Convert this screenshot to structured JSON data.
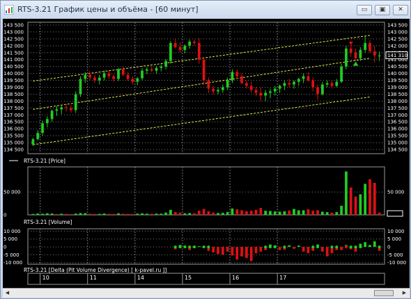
{
  "window": {
    "title": "RTS-3.21 График цены и объёма - [60 минут]",
    "buttons": [
      "minimize",
      "restore",
      "close"
    ],
    "minimize_glyph": "▭",
    "restore_glyph": "▣",
    "close_glyph": "✕"
  },
  "colors": {
    "up": "#22cc22",
    "down": "#dd1111",
    "channel": "#e6e64a",
    "grid": "#7a7a7a",
    "text": "#ffffff",
    "background": "#000000"
  },
  "chart_data": [
    {
      "type": "bar",
      "title": "RTS-3.21 [Price]",
      "ylim": [
        134200,
        143700
      ],
      "y_ticks": [
        "143 500",
        "143 000",
        "142 500",
        "142 000",
        "141 500",
        "141 000",
        "140 500",
        "140 000",
        "139 500",
        "139 000",
        "138 500",
        "138 000",
        "137 500",
        "137 000",
        "136 500",
        "136 000",
        "135 500",
        "135 000",
        "134 500"
      ],
      "y_tick_values": [
        143500,
        143000,
        142500,
        142000,
        141500,
        141000,
        140500,
        140000,
        139500,
        139000,
        138500,
        138000,
        137500,
        137000,
        136500,
        136000,
        135500,
        135000,
        134500
      ],
      "current_price_label": "141 310",
      "current_price": 141310,
      "candles": [
        [
          134850,
          135350,
          134750,
          135250
        ],
        [
          135250,
          135900,
          135150,
          135700
        ],
        [
          135700,
          136600,
          135500,
          136400
        ],
        [
          136400,
          136900,
          136100,
          136700
        ],
        [
          136700,
          137400,
          136500,
          137300
        ],
        [
          137300,
          137650,
          136950,
          137400
        ],
        [
          137400,
          137700,
          137050,
          137550
        ],
        [
          137550,
          137800,
          137250,
          137500
        ],
        [
          137500,
          137700,
          137150,
          137350
        ],
        [
          137350,
          138700,
          137150,
          138500
        ],
        [
          138500,
          139800,
          138300,
          139600
        ],
        [
          139600,
          140100,
          139300,
          139900
        ],
        [
          139900,
          140150,
          139500,
          139700
        ],
        [
          139700,
          139900,
          139300,
          139500
        ],
        [
          139500,
          139900,
          139200,
          139700
        ],
        [
          139700,
          140200,
          139500,
          140000
        ],
        [
          140000,
          140250,
          139600,
          139800
        ],
        [
          139800,
          139950,
          139400,
          139600
        ],
        [
          139600,
          140400,
          139450,
          140300
        ],
        [
          140300,
          140500,
          139800,
          139900
        ],
        [
          139900,
          140100,
          139450,
          139600
        ],
        [
          139600,
          139800,
          139200,
          139400
        ],
        [
          139400,
          139750,
          139150,
          139650
        ],
        [
          139650,
          140400,
          139500,
          140200
        ],
        [
          140200,
          140450,
          139950,
          140300
        ],
        [
          140300,
          140500,
          140100,
          140200
        ],
        [
          140200,
          140550,
          139950,
          140400
        ],
        [
          140400,
          140650,
          140150,
          140500
        ],
        [
          140500,
          141050,
          140300,
          140900
        ],
        [
          140900,
          142350,
          140700,
          142200
        ],
        [
          142200,
          142500,
          141800,
          141900
        ],
        [
          141900,
          142250,
          141500,
          141700
        ],
        [
          141700,
          142100,
          141450,
          142000
        ],
        [
          142000,
          142450,
          141800,
          142300
        ],
        [
          142300,
          142450,
          142000,
          142200
        ],
        [
          142200,
          142550,
          140700,
          141000
        ],
        [
          141000,
          141200,
          139200,
          139500
        ],
        [
          139500,
          139700,
          138600,
          138900
        ],
        [
          138900,
          139100,
          138500,
          138700
        ],
        [
          138700,
          139000,
          138500,
          138800
        ],
        [
          138800,
          139200,
          138600,
          139000
        ],
        [
          139000,
          139700,
          138800,
          139500
        ],
        [
          139500,
          140300,
          139300,
          140100
        ],
        [
          140100,
          140300,
          139600,
          139800
        ],
        [
          139800,
          140000,
          139200,
          139300
        ],
        [
          139300,
          139500,
          138900,
          139100
        ],
        [
          139100,
          139400,
          138600,
          138800
        ],
        [
          138800,
          139000,
          138400,
          138600
        ],
        [
          138600,
          139000,
          138000,
          138400
        ],
        [
          138400,
          138800,
          138000,
          138600
        ],
        [
          138600,
          138900,
          138200,
          138700
        ],
        [
          138700,
          139100,
          138400,
          138900
        ],
        [
          138900,
          139200,
          138600,
          139100
        ],
        [
          139100,
          139500,
          138800,
          139300
        ],
        [
          139300,
          139600,
          139000,
          139200
        ],
        [
          139200,
          139500,
          138900,
          139400
        ],
        [
          139400,
          139700,
          139100,
          139600
        ],
        [
          139600,
          140000,
          139300,
          139800
        ],
        [
          139800,
          140100,
          139400,
          139500
        ],
        [
          139500,
          139700,
          138700,
          139000
        ],
        [
          139000,
          139200,
          138100,
          138500
        ],
        [
          138500,
          139400,
          138400,
          139200
        ],
        [
          139200,
          139500,
          139000,
          139300
        ],
        [
          139300,
          139500,
          138900,
          139100
        ],
        [
          139100,
          139600,
          139000,
          139400
        ],
        [
          139400,
          140700,
          139300,
          140500
        ],
        [
          140500,
          142000,
          140300,
          141800
        ],
        [
          141800,
          142200,
          141200,
          141500
        ],
        [
          141500,
          141800,
          140900,
          141100
        ],
        [
          141100,
          141900,
          140900,
          141700
        ],
        [
          141700,
          142700,
          141500,
          142200
        ],
        [
          142200,
          142400,
          141500,
          141600
        ],
        [
          141600,
          142000,
          140800,
          141300
        ],
        [
          141300,
          141600,
          140900,
          141300
        ]
      ],
      "arrows": [
        {
          "type": "sell",
          "index": 67,
          "price": 142150
        },
        {
          "type": "buy",
          "index": 68,
          "price": 140700
        }
      ],
      "channels": [
        [
          [
            0,
            139450
          ],
          [
            71,
            142750
          ]
        ],
        [
          [
            0,
            137400
          ],
          [
            71,
            141100
          ]
        ],
        [
          [
            0,
            134850
          ],
          [
            71,
            138300
          ]
        ]
      ]
    },
    {
      "type": "bar",
      "title": "RTS-3.21 [Volume]",
      "ylim": [
        0,
        105000
      ],
      "y_ticks": [
        "50 000"
      ],
      "y_tick_values": [
        50000
      ],
      "values": [
        2000,
        3000,
        2500,
        3500,
        3000,
        2000,
        2500,
        2200,
        1800,
        2800,
        4000,
        3800,
        2500,
        2000,
        2200,
        3000,
        2200,
        2000,
        3500,
        2500,
        2200,
        2000,
        2800,
        3500,
        2600,
        2400,
        2800,
        2600,
        5000,
        11000,
        6000,
        5000,
        3500,
        4000,
        3500,
        9000,
        13000,
        8000,
        5000,
        4000,
        4500,
        6000,
        14000,
        12000,
        10000,
        8000,
        9000,
        11000,
        15000,
        9000,
        8500,
        7500,
        7000,
        8000,
        9500,
        13000,
        10000,
        10000,
        12000,
        9000,
        10000,
        7000,
        6000,
        5000,
        6000,
        20000,
        95000,
        60000,
        40000,
        45000,
        68000,
        78000,
        70000,
        5000
      ],
      "directions": [
        "up",
        "up",
        "up",
        "up",
        "up",
        "down",
        "up",
        "down",
        "down",
        "up",
        "up",
        "up",
        "down",
        "down",
        "up",
        "up",
        "down",
        "down",
        "up",
        "down",
        "down",
        "down",
        "up",
        "up",
        "up",
        "down",
        "up",
        "up",
        "up",
        "up",
        "down",
        "down",
        "up",
        "up",
        "down",
        "down",
        "down",
        "down",
        "down",
        "up",
        "up",
        "up",
        "up",
        "down",
        "down",
        "down",
        "down",
        "down",
        "down",
        "up",
        "up",
        "up",
        "up",
        "up",
        "down",
        "up",
        "up",
        "up",
        "down",
        "down",
        "down",
        "up",
        "up",
        "down",
        "up",
        "up",
        "up",
        "down",
        "down",
        "up",
        "up",
        "down",
        "down",
        "down"
      ]
    },
    {
      "type": "bar",
      "title": "RTS-3.21 [Delta (Pit Volume Divergence) [ k-pavel.ru ]]",
      "ylim": [
        -11000,
        11500
      ],
      "y_ticks_left": [
        "10 000",
        "5 000",
        "0",
        "-5 000",
        "-10 000"
      ],
      "y_ticks_right": [
        "10 000",
        "5 000",
        "0",
        "-5 000",
        "-10 000"
      ],
      "y_tick_values": [
        10000,
        5000,
        0,
        -5000,
        -10000
      ],
      "start_index": 30,
      "values": [
        -1500,
        1200,
        800,
        -2000,
        600,
        400,
        -300,
        -2500,
        -3500,
        -4500,
        -5000,
        -3000,
        -5500,
        -8000,
        -6000,
        -7000,
        -9000,
        -4000,
        -3000,
        -2000,
        1500,
        1000,
        -2000,
        -1800,
        1000,
        -1200,
        800,
        -3000,
        -4000,
        -2500,
        1500,
        -3000,
        -6000,
        -4000,
        -2000,
        -2000,
        1200,
        -1500,
        -3000,
        2000,
        3000,
        1200,
        3500,
        -2500,
        4000,
        3000,
        9500,
        4500,
        -2000
      ],
      "dots": [
        [
          30,
          0
        ],
        [
          31,
          0
        ],
        [
          32,
          0
        ],
        [
          33,
          0
        ],
        [
          34,
          0
        ],
        [
          36,
          0
        ],
        [
          37,
          0
        ],
        [
          49,
          0
        ],
        [
          50,
          0
        ],
        [
          51,
          0
        ],
        [
          53,
          0
        ],
        [
          59,
          0
        ],
        [
          60,
          0
        ],
        [
          63,
          0
        ],
        [
          64,
          0
        ],
        [
          66,
          0
        ],
        [
          67,
          0
        ],
        [
          68,
          0
        ],
        [
          69,
          0
        ],
        [
          73,
          0
        ]
      ],
      "dot_colors": [
        "up",
        "up",
        "up",
        "up",
        "up",
        "up",
        "up",
        "up",
        "up",
        "up",
        "up",
        "up",
        "up",
        "up",
        "up",
        "down",
        "up",
        "up",
        "up",
        "up"
      ]
    }
  ],
  "x_axis": {
    "day_labels": [
      "10",
      "11",
      "14",
      "15",
      "16",
      "17"
    ],
    "day_start_indices": [
      2,
      12,
      22,
      32,
      42,
      52
    ]
  }
}
